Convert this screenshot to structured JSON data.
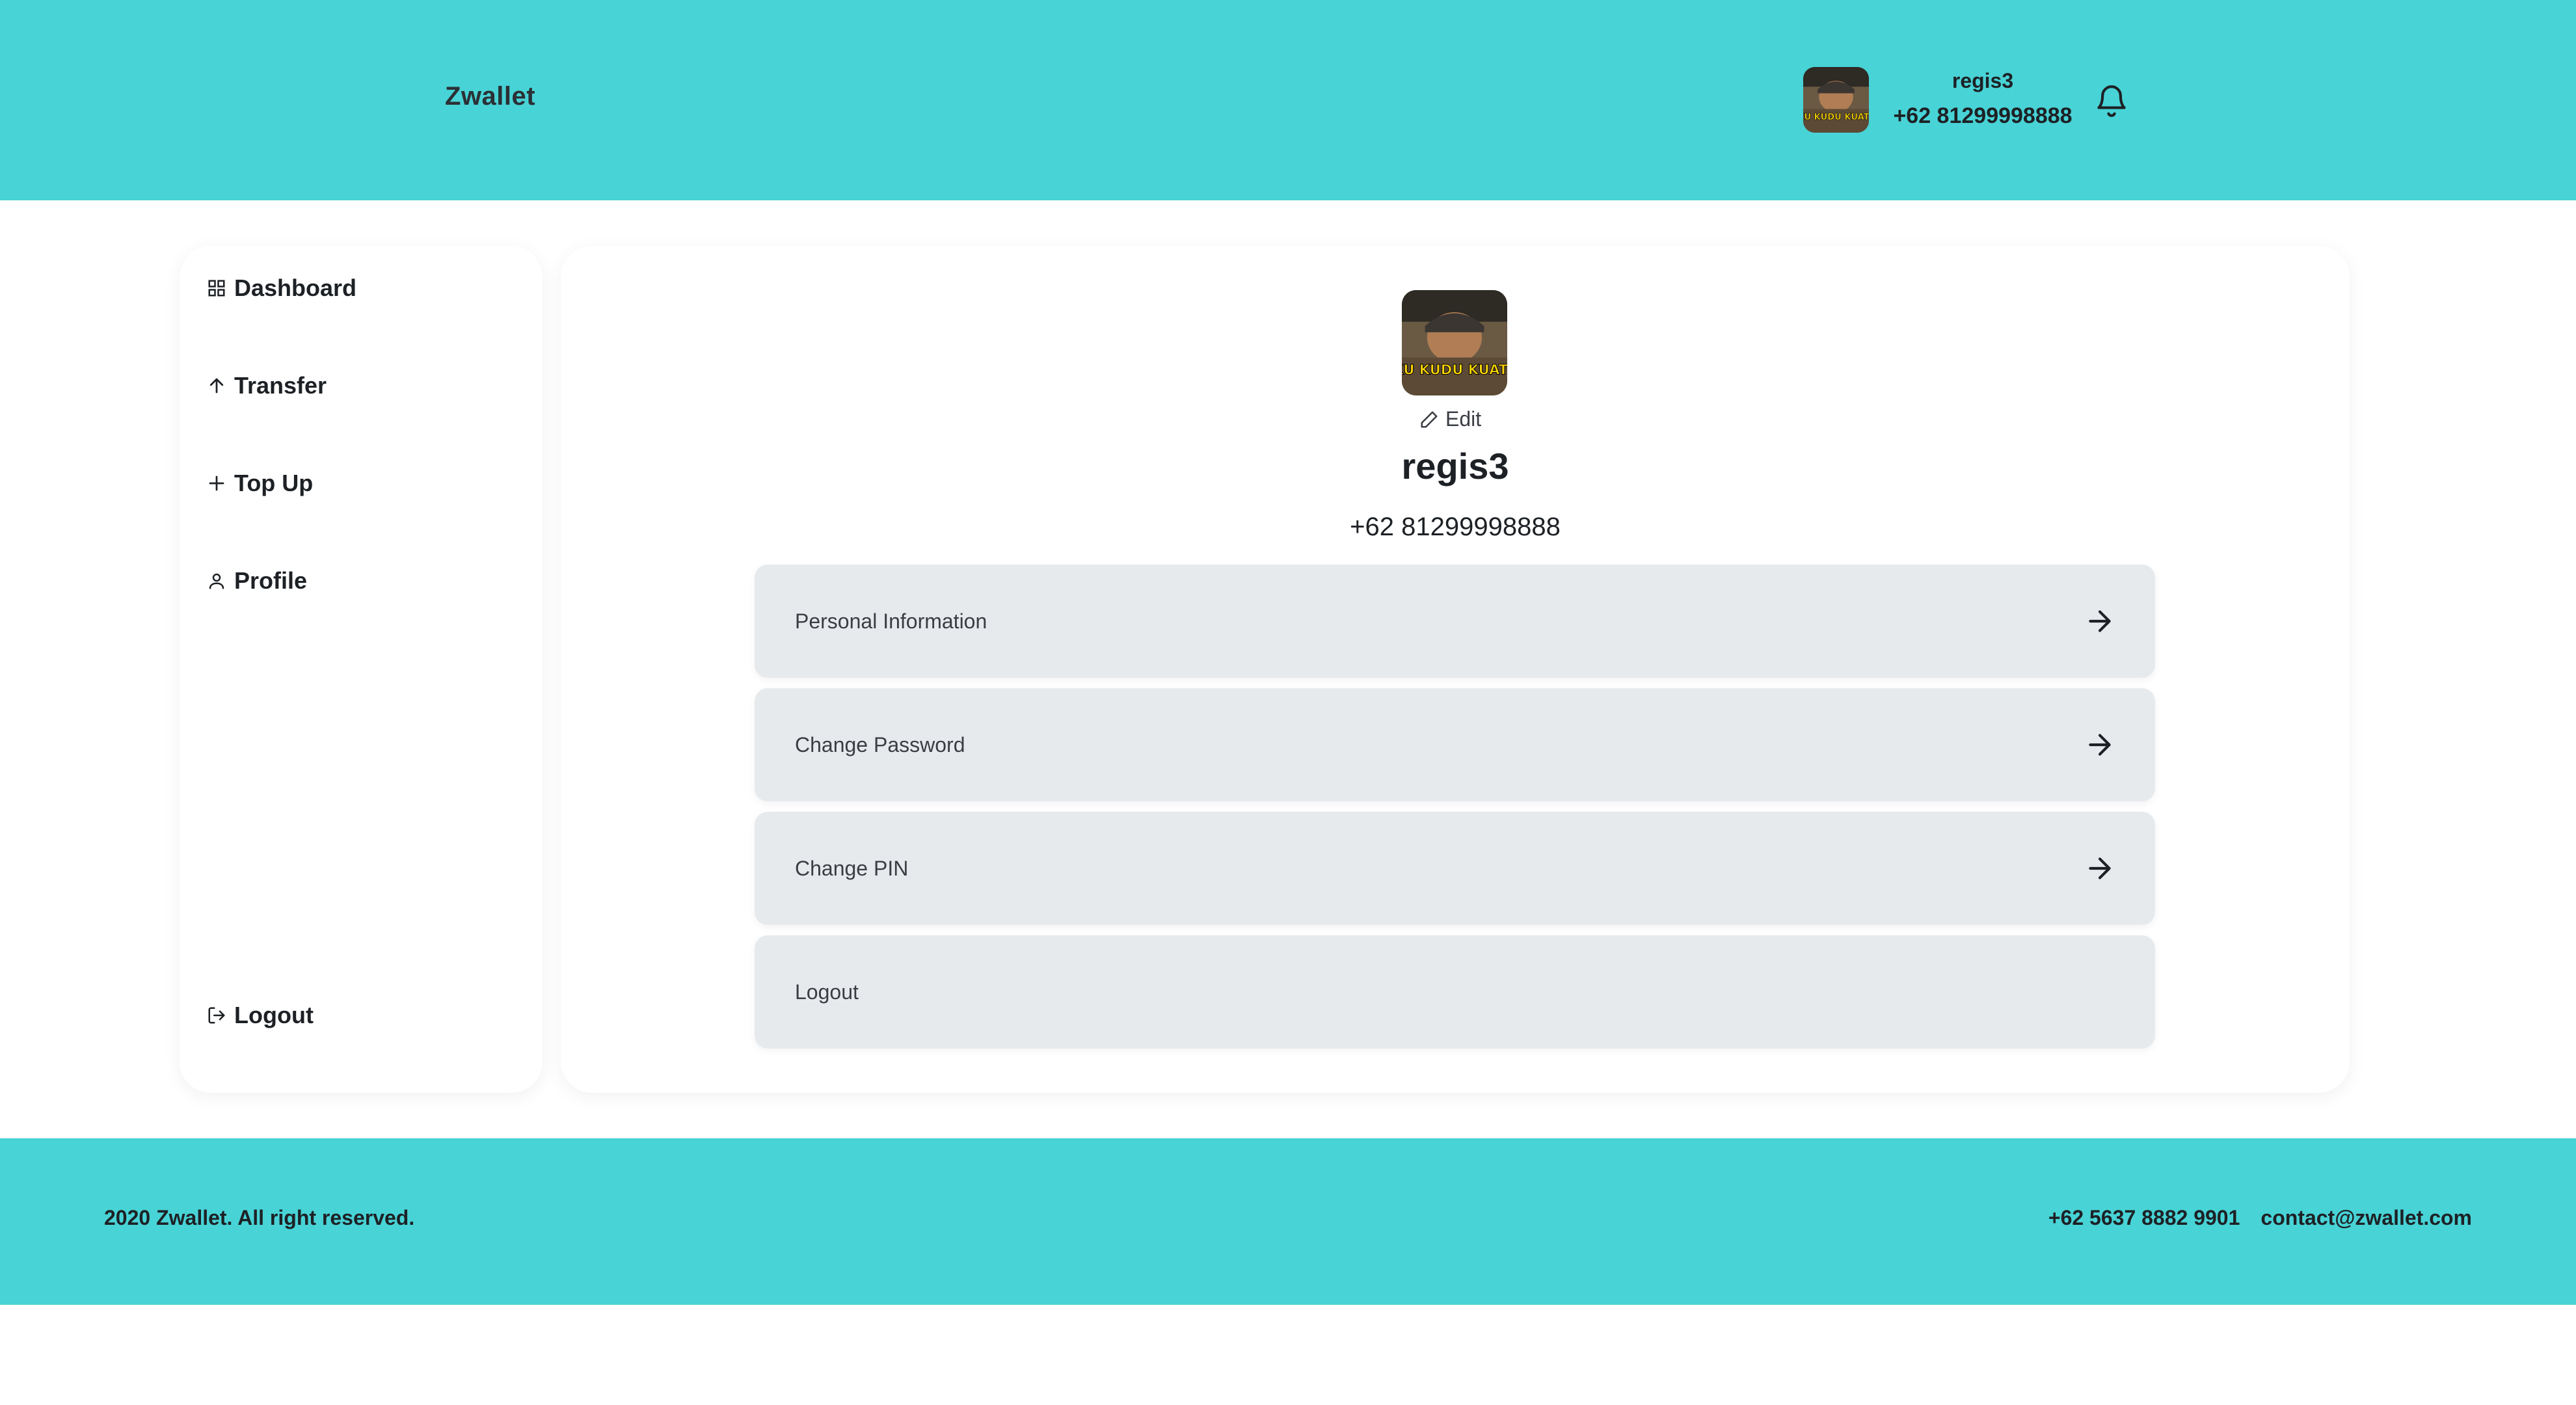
{
  "header": {
    "brand": "Zwallet",
    "user_name": "regis3",
    "user_phone": "+62 81299998888",
    "notification_icon": "bell-icon"
  },
  "sidebar": {
    "items": [
      {
        "label": "Dashboard",
        "icon": "grid-icon"
      },
      {
        "label": "Transfer",
        "icon": "arrow-up-icon"
      },
      {
        "label": "Top Up",
        "icon": "plus-icon"
      },
      {
        "label": "Profile",
        "icon": "user-icon"
      }
    ],
    "logout": {
      "label": "Logout",
      "icon": "logout-icon"
    }
  },
  "profile": {
    "photo_caption": "AKU KUDU KUAT!!!",
    "edit_label": "Edit",
    "name": "regis3",
    "phone": "+62 81299998888"
  },
  "menu": [
    {
      "label": "Personal Information",
      "has_arrow": true
    },
    {
      "label": "Change Password",
      "has_arrow": true
    },
    {
      "label": "Change PIN",
      "has_arrow": true
    },
    {
      "label": "Logout",
      "has_arrow": false
    }
  ],
  "footer": {
    "copyright": "2020 Zwallet. All right reserved.",
    "phone": "+62 5637 8882 9901",
    "email": "contact@zwallet.com"
  },
  "colors": {
    "accent": "#48d3d6",
    "menu_bg": "#e7eaed",
    "text_dark": "#1d2125"
  }
}
